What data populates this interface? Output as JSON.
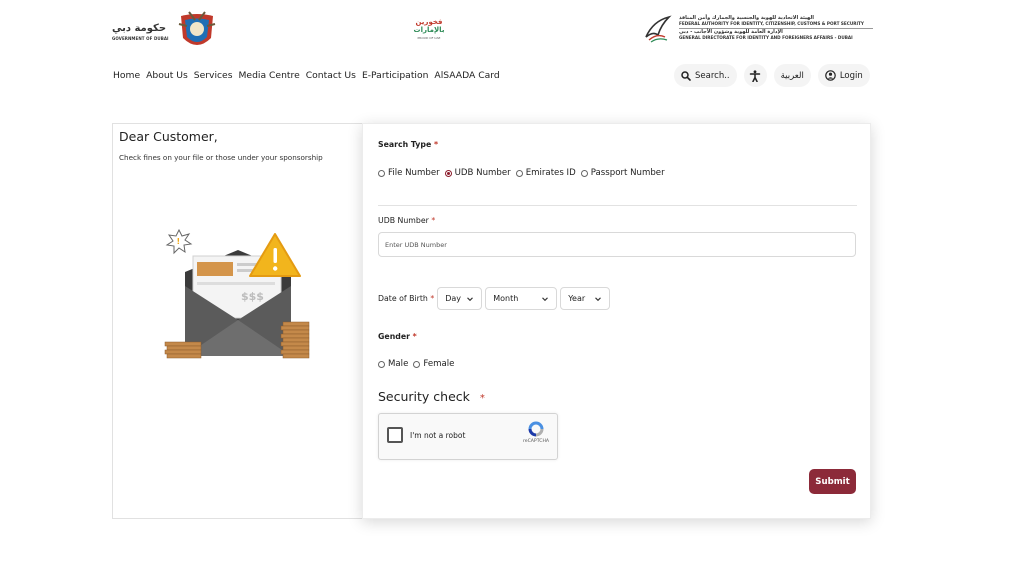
{
  "header": {
    "gov_logo_ar": "حكومة دبي",
    "gov_logo_en": "GOVERNMENT OF DUBAI",
    "center_logo_ar_line1": "فخورين",
    "center_logo_ar_line2": "بالإمارات",
    "center_logo_en": "PROUD OF UAE",
    "authority_ar_1": "الهيئة الاتحادية للهوية والجنسية والجمارك وأمن المنافذ",
    "authority_en_1": "FEDERAL AUTHORITY FOR IDENTITY, CITIZENSHIP, CUSTOMS & PORT SECURITY",
    "authority_ar_2": "الإدارة العامة للهوية وشؤون الأجانب - دبي",
    "authority_en_2": "GENERAL DIRECTORATE FOR IDENTITY AND FOREIGNERS AFFAIRS - DUBAI"
  },
  "nav": {
    "items": [
      "Home",
      "About Us",
      "Services",
      "Media Centre",
      "Contact Us",
      "E-Participation",
      "AlSAADA Card"
    ],
    "search_label": "Search..",
    "arabic_label": "العربية",
    "login_label": "Login"
  },
  "left": {
    "greeting": "Dear Customer,",
    "subtext": "Check fines on your file or those under your sponsorship",
    "illus_text": "$$$"
  },
  "form": {
    "search_type_label": "Search Type",
    "required_mark": "*",
    "search_types": [
      {
        "label": "File Number",
        "checked": false
      },
      {
        "label": "UDB Number",
        "checked": true
      },
      {
        "label": "Emirates ID",
        "checked": false
      },
      {
        "label": "Passport Number",
        "checked": false
      }
    ],
    "udb_label": "UDB Number",
    "udb_placeholder": "Enter UDB Number",
    "udb_value": "",
    "dob_label": "Date of Birth",
    "dob_day": "Day",
    "dob_month": "Month",
    "dob_year": "Year",
    "gender_label": "Gender",
    "genders": [
      {
        "label": "Male",
        "checked": false
      },
      {
        "label": "Female",
        "checked": false
      }
    ],
    "security_label": "Security check",
    "captcha_text": "I'm not a robot",
    "captcha_brand": "reCAPTCHA",
    "submit_label": "Submit"
  },
  "colors": {
    "accent": "#8c2a39",
    "required": "#c0392b"
  }
}
